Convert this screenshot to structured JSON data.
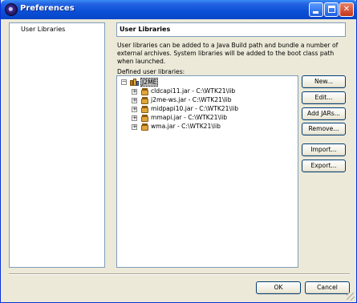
{
  "window": {
    "title": "Preferences",
    "icons": {
      "app": "eclipse-icon",
      "minimize": "minimize-icon",
      "maximize": "maximize-icon",
      "close": "close-icon"
    },
    "close_glyph": "✕"
  },
  "nav": {
    "items": [
      {
        "label": "User Libraries"
      }
    ]
  },
  "page": {
    "title": "User Libraries",
    "description": "User libraries can be added to a Java Build path and bundle a number of external archives. System libraries will be added to the boot class path when launched.",
    "defined_label": "Defined user libraries:"
  },
  "tree": {
    "root": {
      "label": "J2ME",
      "expanded": true,
      "selected": true,
      "icon": "library-icon"
    },
    "children": [
      {
        "label": "cldcapi11.jar - C:\\WTK21\\lib",
        "icon": "jar-icon"
      },
      {
        "label": "j2me-ws.jar - C:\\WTK21\\lib",
        "icon": "jar-icon"
      },
      {
        "label": "midpapi10.jar - C:\\WTK21\\lib",
        "icon": "jar-icon"
      },
      {
        "label": "mmapi.jar - C:\\WTK21\\lib",
        "icon": "jar-icon"
      },
      {
        "label": "wma.jar - C:\\WTK21\\lib",
        "icon": "jar-icon"
      }
    ],
    "collapse_glyph": "−",
    "expand_glyph": "+"
  },
  "buttons": {
    "new": "New...",
    "edit": "Edit...",
    "add_jars": "Add JARs...",
    "remove": "Remove...",
    "import": "Import...",
    "export": "Export...",
    "ok": "OK",
    "cancel": "Cancel"
  },
  "colors": {
    "title_bar": "#0a4fd6",
    "selection": "#c0c0c0",
    "border": "#7f9db9",
    "dialog": "#ece9d8"
  }
}
